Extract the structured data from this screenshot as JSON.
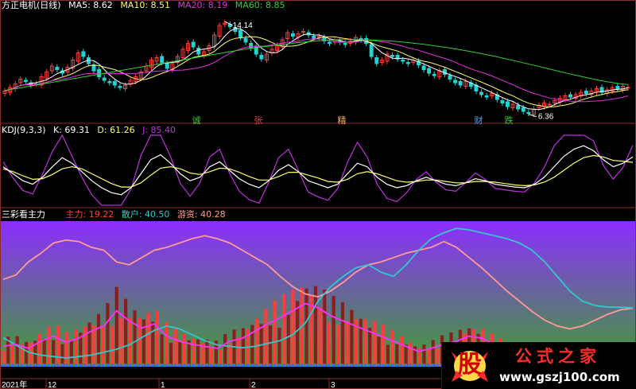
{
  "colors": {
    "background": "#000000",
    "panel_border": "#8a2c2c",
    "candle_up": "#ff3c3c",
    "candle_down": "#22d3d3",
    "ma5": "#ffffff",
    "ma10": "#ffff66",
    "ma20": "#e030e0",
    "ma60": "#2fd12f",
    "kdj_k": "#ffffff",
    "kdj_d": "#ffff66",
    "kdj_j": "#c030e0",
    "zhuli": "#ff3c3c",
    "sanhu": "#33c7cc",
    "youzi": "#ff9a9a",
    "magenta_line": "#ff30ff",
    "gradient_top": "#8c2dff",
    "gradient_bottom": "#40a030"
  },
  "panel1": {
    "title": "方正电机(日线)",
    "indicators": [
      {
        "label": "MA5: 8.62",
        "color": "#ffffff"
      },
      {
        "label": "MA10: 8.51",
        "color": "#ffff66"
      },
      {
        "label": "MA20: 8.19",
        "color": "#e030e0"
      },
      {
        "label": "MA60: 8.85",
        "color": "#2fd12f"
      }
    ],
    "high_label": "14.14",
    "low_label": "6.36",
    "signals": [
      {
        "text": "诚",
        "color": "#2fd12f"
      },
      {
        "text": "张",
        "color": "#ff3c3c"
      },
      {
        "text": "精",
        "color": "#ffb060"
      },
      {
        "text": "财",
        "color": "#4fa0ff"
      },
      {
        "text": "跌",
        "color": "#2fd12f"
      }
    ]
  },
  "panel2": {
    "title": "KDJ(9,3,3)",
    "indicators": [
      {
        "label": "K: 69.31",
        "color": "#ffffff"
      },
      {
        "label": "D: 61.26",
        "color": "#ffff66"
      },
      {
        "label": "J: 85.40",
        "color": "#c030e0"
      }
    ]
  },
  "panel3": {
    "title": "三彩看主力",
    "indicators": [
      {
        "label": "主力: 19.22",
        "color": "#ff3c3c"
      },
      {
        "label": "散户: 40.50",
        "color": "#33c7cc"
      },
      {
        "label": "游资: 40.28",
        "color": "#ff9a9a"
      }
    ]
  },
  "xaxis": {
    "labels": [
      "2021年",
      "12",
      "1",
      "2",
      "3"
    ]
  },
  "logo": {
    "mark": "股",
    "name": "公式之家",
    "url": "www.gszj100.com"
  },
  "chart_data": [
    {
      "type": "candlestick",
      "name": "方正电机(日线)",
      "ylim": [
        5.8,
        15.0
      ],
      "high": 14.14,
      "low": 6.36,
      "close": [
        8.3,
        8.6,
        8.9,
        9.3,
        9.1,
        8.8,
        8.9,
        9.5,
        9.9,
        10.4,
        10.1,
        9.8,
        10.3,
        10.9,
        11.5,
        11.2,
        10.6,
        10.0,
        9.5,
        9.2,
        9.0,
        8.8,
        8.6,
        8.8,
        9.2,
        9.5,
        9.9,
        10.4,
        10.9,
        11.1,
        10.7,
        10.2,
        10.6,
        11.2,
        11.8,
        12.3,
        12.0,
        11.4,
        11.6,
        12.1,
        13.0,
        13.8,
        14.0,
        13.7,
        13.3,
        12.8,
        12.4,
        11.9,
        11.4,
        11.0,
        11.4,
        11.8,
        12.1,
        12.6,
        13.2,
        12.9,
        13.1,
        13.3,
        13.0,
        12.7,
        12.9,
        12.5,
        12.3,
        12.6,
        12.4,
        12.2,
        12.5,
        12.8,
        12.6,
        12.3,
        11.2,
        10.6,
        10.9,
        11.4,
        11.2,
        11.0,
        10.8,
        10.6,
        10.9,
        10.5,
        10.1,
        9.8,
        9.6,
        10.0,
        9.7,
        9.3,
        9.0,
        8.8,
        9.1,
        8.7,
        8.3,
        8.0,
        7.8,
        8.1,
        7.6,
        7.3,
        7.0,
        7.2,
        6.8,
        6.6,
        6.45,
        6.8,
        7.1,
        7.3,
        7.2,
        7.5,
        7.7,
        7.9,
        7.8,
        8.0,
        8.2,
        8.1,
        8.3,
        8.5,
        8.2,
        8.4,
        8.6,
        8.5,
        8.7,
        8.62
      ],
      "ma60": [
        8.35,
        8.45,
        8.55,
        8.65,
        8.75,
        8.85,
        8.95,
        9.05,
        9.15,
        9.25,
        9.35,
        9.45,
        9.55,
        9.65,
        9.75,
        9.85,
        9.95,
        10.05,
        10.15,
        10.25,
        10.35,
        10.45,
        10.55,
        10.65,
        10.75,
        10.85,
        10.95,
        11.05,
        11.15,
        11.25,
        11.35,
        11.45,
        11.55,
        11.65,
        11.75,
        11.85,
        11.92,
        11.99,
        12.06,
        12.13,
        12.2,
        12.27,
        12.34,
        12.4,
        12.45,
        12.5,
        12.54,
        12.58,
        12.6,
        12.61,
        12.62,
        12.61,
        12.6,
        12.58,
        12.55,
        12.52,
        12.48,
        12.43,
        12.38,
        12.32,
        12.25,
        12.18,
        12.1,
        12.02,
        11.93,
        11.84,
        11.74,
        11.64,
        11.53,
        11.42,
        11.3,
        11.18,
        11.05,
        10.92,
        10.79,
        10.65,
        10.52,
        10.38,
        10.24,
        10.1,
        9.96,
        9.82,
        9.69,
        9.56,
        9.43,
        9.3,
        9.18,
        9.08,
        8.98,
        8.9,
        8.85
      ]
    },
    {
      "type": "line",
      "name": "KDJ(9,3,3)",
      "ylim": [
        0,
        100
      ],
      "series": [
        {
          "name": "K",
          "values": [
            55,
            45,
            35,
            30,
            40,
            55,
            68,
            60,
            48,
            35,
            25,
            18,
            15,
            25,
            45,
            65,
            72,
            60,
            45,
            35,
            40,
            55,
            62,
            50,
            38,
            30,
            25,
            35,
            50,
            58,
            48,
            35,
            30,
            25,
            30,
            45,
            60,
            55,
            40,
            30,
            25,
            28,
            35,
            40,
            35,
            30,
            28,
            32,
            38,
            35,
            30,
            28,
            26,
            25,
            30,
            40,
            55,
            70,
            80,
            85,
            78,
            65,
            55,
            60,
            69
          ]
        },
        {
          "name": "D",
          "values": [
            52,
            48,
            42,
            37,
            38,
            44,
            52,
            55,
            52,
            45,
            38,
            31,
            26,
            26,
            32,
            43,
            53,
            55,
            52,
            46,
            44,
            48,
            53,
            52,
            47,
            41,
            36,
            36,
            41,
            47,
            47,
            43,
            39,
            34,
            33,
            37,
            45,
            48,
            45,
            40,
            35,
            33,
            34,
            36,
            36,
            34,
            32,
            32,
            34,
            34,
            33,
            31,
            29,
            28,
            29,
            33,
            40,
            50,
            60,
            68,
            71,
            69,
            64,
            63,
            61.26
          ]
        },
        {
          "name": "J",
          "values": [
            62,
            39,
            21,
            16,
            44,
            77,
            100,
            70,
            40,
            15,
            0,
            0,
            0,
            23,
            71,
            100,
            100,
            70,
            31,
            13,
            32,
            69,
            80,
            46,
            20,
            8,
            3,
            33,
            68,
            80,
            50,
            19,
            12,
            7,
            24,
            61,
            90,
            69,
            30,
            10,
            5,
            18,
            37,
            48,
            33,
            22,
            20,
            32,
            46,
            37,
            24,
            22,
            20,
            19,
            32,
            54,
            85,
            100,
            100,
            100,
            92,
            57,
            37,
            54,
            85.4
          ]
        }
      ]
    },
    {
      "type": "bar+line",
      "name": "三彩看主力",
      "ylim": [
        0,
        100
      ],
      "series": [
        {
          "name": "主力",
          "values": [
            20,
            22,
            18,
            25,
            30,
            24,
            28,
            35,
            40,
            55,
            45,
            38,
            42,
            30,
            25,
            22,
            20,
            18,
            25,
            28,
            35,
            42,
            48,
            55,
            62,
            58,
            50,
            45,
            40,
            35,
            30,
            25,
            20,
            15,
            18,
            22,
            25,
            30,
            28,
            22,
            18,
            15,
            12,
            10,
            8,
            6,
            5,
            4,
            3,
            2,
            19.22
          ]
        },
        {
          "name": "散户",
          "values": [
            20,
            15,
            10,
            8,
            7,
            6,
            7,
            8,
            10,
            12,
            15,
            20,
            25,
            28,
            26,
            22,
            18,
            15,
            14,
            13,
            14,
            16,
            18,
            22,
            30,
            45,
            55,
            62,
            68,
            70,
            65,
            62,
            70,
            80,
            88,
            92,
            95,
            94,
            92,
            90,
            88,
            85,
            80,
            72,
            62,
            52,
            45,
            42,
            41,
            40.8,
            40.5
          ]
        },
        {
          "name": "游资",
          "values": [
            60,
            63,
            72,
            78,
            85,
            87,
            86,
            82,
            80,
            72,
            70,
            75,
            80,
            82,
            85,
            88,
            90,
            88,
            85,
            80,
            75,
            70,
            62,
            55,
            50,
            48,
            52,
            58,
            65,
            70,
            72,
            75,
            78,
            80,
            82,
            86,
            82,
            75,
            68,
            60,
            52,
            45,
            38,
            32,
            28,
            26,
            28,
            32,
            36,
            39,
            40.28
          ]
        }
      ]
    }
  ]
}
